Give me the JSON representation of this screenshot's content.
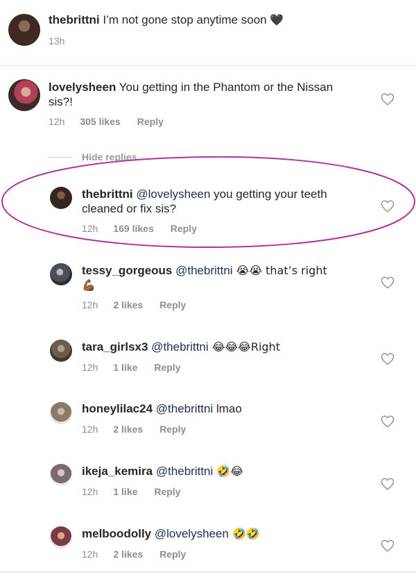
{
  "top": {
    "username": "thebrittni",
    "text": " I’m not gone stop anytime soon ",
    "emoji": "🖤",
    "time": "13h"
  },
  "main": {
    "username": "lovelysheen",
    "line1": " You getting in the Phantom or the Nissan",
    "line2": "sis?!",
    "time": "12h",
    "likes": "305 likes",
    "reply": "Reply"
  },
  "hide_replies": "Hide replies",
  "replies": [
    {
      "username": "thebrittni",
      "mention": "@lovelysheen",
      "text": " you getting your teeth",
      "text2": "cleaned or fix sis?",
      "time": "12h",
      "likes": "169 likes",
      "reply": "Reply"
    },
    {
      "username": "tessy_gorgeous",
      "mention": "@thebrittni",
      "text": " 😭😭 that’s right",
      "text2": "💪🏾",
      "time": "12h",
      "likes": "2 likes",
      "reply": "Reply"
    },
    {
      "username": "tara_girlsx3",
      "mention": "@thebrittni",
      "text": " 😂😂😂Right",
      "time": "12h",
      "likes": "1 like",
      "reply": "Reply"
    },
    {
      "username": "honeylilac24",
      "mention": "@thebrittni",
      "text": " lmao",
      "time": "12h",
      "likes": "2 likes",
      "reply": "Reply"
    },
    {
      "username": "ikeja_kemira",
      "mention": "@thebrittni",
      "text": " 🤣😂",
      "time": "12h",
      "likes": "1 like",
      "reply": "Reply"
    },
    {
      "username": "melboodolly",
      "mention": "@lovelysheen",
      "text": " 🤣🤣",
      "time": "12h",
      "likes": "2 likes",
      "reply": "Reply"
    }
  ],
  "colors": {
    "highlight": "#b0329e",
    "mention": "#1b2d5a",
    "meta": "#8e8e8e"
  }
}
